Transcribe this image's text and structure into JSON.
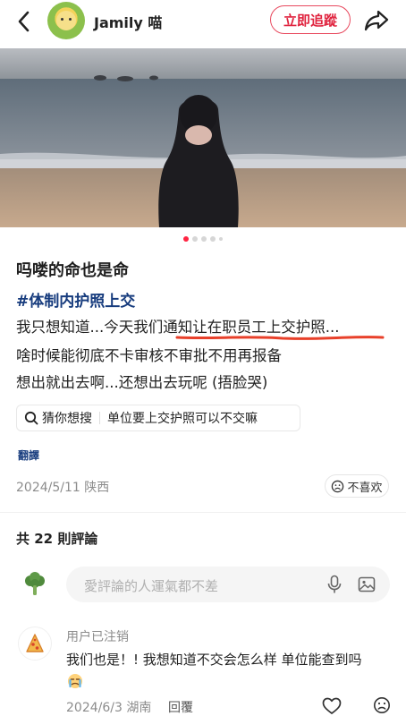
{
  "header": {
    "username": "Jamily 喵",
    "follow_label": "立即追蹤"
  },
  "post": {
    "title": "吗喽的命也是命",
    "hashtag": "#体制内护照上交",
    "lines": [
      "我只想知道...今天我们通知让在职员工上交护照...",
      "啥时候能彻底不卡审核不审批不用再报备",
      "想出就出去啊...还想出去玩呢 (捂脸哭)"
    ],
    "search_chip": {
      "label": "猜你想搜",
      "query": "单位要上交护照可以不交嘛"
    },
    "translate_label": "翻譯",
    "meta": "2024/5/11 陕西",
    "dislike_label": "不喜欢",
    "carousel": {
      "count": 5,
      "active_index": 0
    }
  },
  "comments": {
    "count_label": "共 22 則評論",
    "input_placeholder": "愛評論的人運氣都不差",
    "items": [
      {
        "user": "用户已注销",
        "text": "我们也是！! 我想知道不交会怎么样 单位能查到吗",
        "meta": "2024/6/3 湖南",
        "reply_label": "回覆"
      }
    ]
  },
  "colors": {
    "accent": "#ff2442",
    "hashtag": "#163b7d",
    "underline": "#e8402a"
  }
}
